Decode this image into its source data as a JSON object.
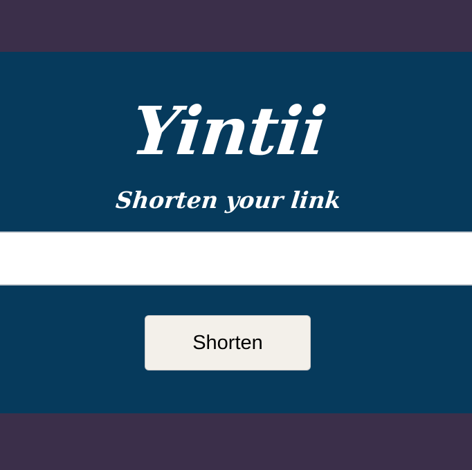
{
  "brand": {
    "logo_text": "Yintii",
    "tagline": "Shorten your link"
  },
  "form": {
    "url_value": "",
    "url_placeholder": "",
    "submit_label": "Shorten"
  },
  "colors": {
    "outer_background": "#3b2f4a",
    "panel_background": "#063a5c",
    "input_background": "#ffffff",
    "button_background": "#f3f0ea",
    "text_light": "#ffffff"
  }
}
